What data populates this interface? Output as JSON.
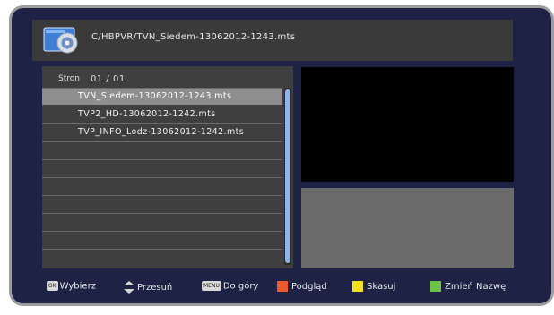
{
  "colors": {
    "frame": "#1e2346",
    "frame_border": "#9c9c9c",
    "panel": "#3f3f3f",
    "selected_row": "#8e8e8e",
    "scroll_thumb": "#8fb4e6",
    "red_key": "#e8592b",
    "yellow_key": "#f2e21b",
    "green_key": "#6cc04a"
  },
  "header": {
    "icon": "disc-folder-icon",
    "path": "C/HBPVR/TVN_Siedem-13062012-1243.mts"
  },
  "file_browser": {
    "page_label": "Stron",
    "page_value": "01 / 01",
    "files": [
      "TVN_Siedem-13062012-1243.mts",
      "TVP2_HD-13062012-1242.mts",
      "TVP_INFO_Lodz-13062012-1242.mts"
    ],
    "selected_index": 0
  },
  "footer": {
    "ok_badge": "OK",
    "select_label": "Wybierz",
    "move_label": "Przesuń",
    "menu_badge": "MENU",
    "up_label": "Do góry",
    "preview_label": "Podgląd",
    "delete_label": "Skasuj",
    "rename_label": "Zmień Nazwę"
  }
}
